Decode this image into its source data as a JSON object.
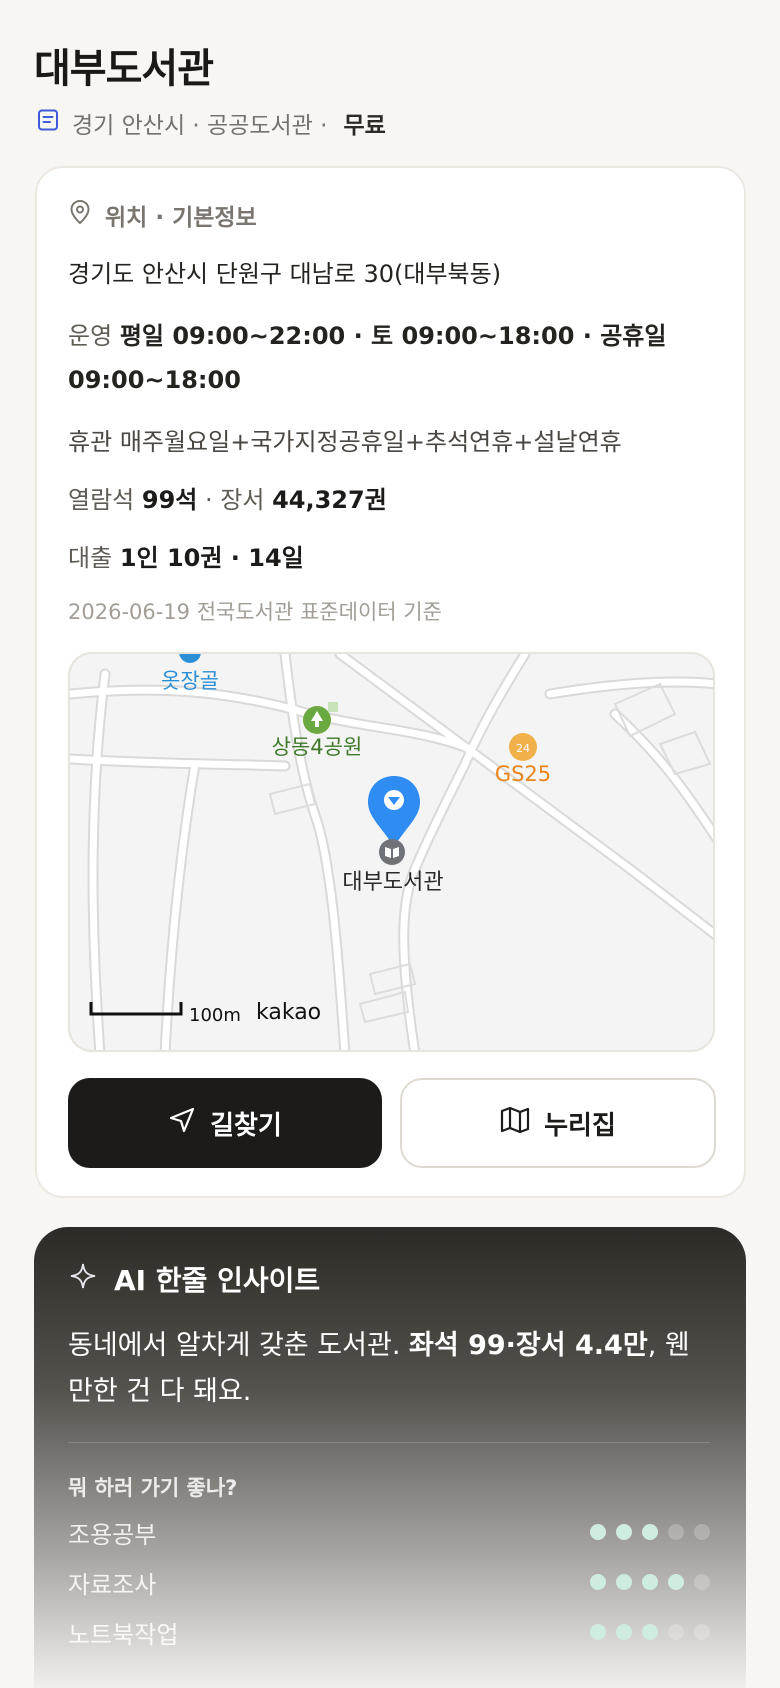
{
  "header": {
    "title": "대부도서관",
    "meta": "경기 안산시 · 공공도서관 ·",
    "fee": "무료"
  },
  "info": {
    "section_title": "위치 · 기본정보",
    "address": "경기도 안산시 단원구 대남로 30(대부북동)",
    "hours_label": "운영",
    "hours_value": "평일 09:00~22:00 · 토 09:00~18:00 · 공휴일 09:00~18:00",
    "closed_label": "휴관",
    "closed_value": "매주월요일+국가지정공휴일+추석연휴+설날연휴",
    "seats_label": "열람석",
    "seats_value": "99석",
    "books_label": "· 장서",
    "books_value": "44,327권",
    "loan_label": "대출",
    "loan_value": "1인 10권 · 14일",
    "basis": "2026-06-19 전국도서관 표준데이터 기준"
  },
  "map": {
    "labels": {
      "okjanggol": "옷장골",
      "park": "상동4공원",
      "gs25": "GS25",
      "gs25_badge": "24",
      "library": "대부도서관",
      "scale": "100m",
      "provider": "kakao"
    },
    "colors": {
      "pin": "#2f8cf3",
      "park": "#3f7a2a",
      "store": "#e8861d",
      "water": "#2c8fd6"
    }
  },
  "actions": {
    "directions": "길찾기",
    "website": "누리집"
  },
  "ai": {
    "title": "AI 한줄 인사이트",
    "text_plain": "동네에서 알차게 갖춘 도서관.",
    "text_bold": "좌석 99·장서 4.4만",
    "text_tail": ", 웬만한 건 다 돼요.",
    "question": "뭐 하러 가기 좋나?",
    "ratings": [
      {
        "label": "조용공부",
        "score": 3,
        "max": 5
      },
      {
        "label": "자료조사",
        "score": 4,
        "max": 5
      },
      {
        "label": "노트북작업",
        "score": 3,
        "max": 5
      }
    ]
  }
}
